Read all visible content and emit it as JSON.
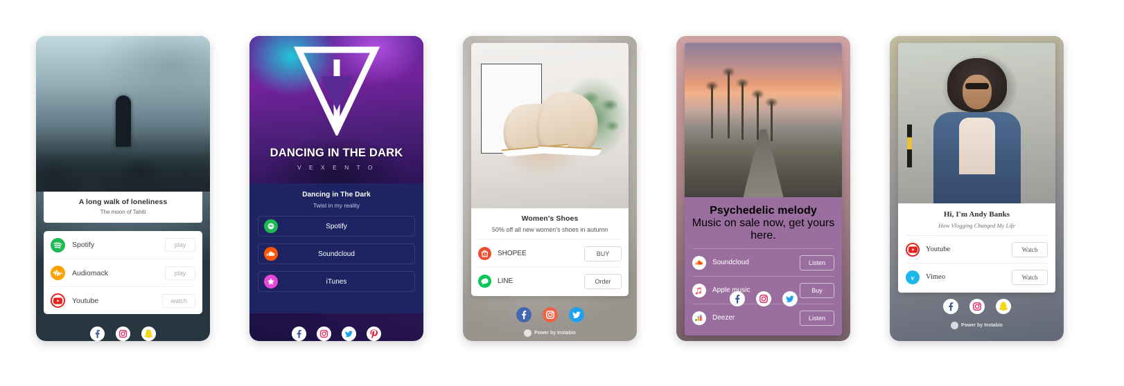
{
  "gallery": {
    "cards": [
      {
        "id": "card-music-loneliness",
        "theme_color": "#ffffff",
        "title": "A long walk of loneliness",
        "subtitle": "The moon of Tahiti",
        "links": [
          {
            "icon": "spotify-icon",
            "label": "Spotify",
            "action": "play"
          },
          {
            "icon": "audiomack-icon",
            "label": "Audiomack",
            "action": "play"
          },
          {
            "icon": "youtube-icon",
            "label": "Youtube",
            "action": "watch"
          }
        ],
        "social": [
          "facebook-icon",
          "instagram-icon",
          "snapchat-icon"
        ],
        "powered_by": ""
      },
      {
        "id": "card-dancing-in-the-dark",
        "theme_color": "#1e2461",
        "hero_title": "DANCING IN THE DARK",
        "hero_subtitle": "V E X E N T O",
        "title": "Dancing in The Dark",
        "subtitle": "Twist in my reality",
        "links": [
          {
            "icon": "spotify-icon",
            "label": "Spotify",
            "action": ""
          },
          {
            "icon": "soundcloud-icon",
            "label": "Soundcloud",
            "action": ""
          },
          {
            "icon": "itunes-icon",
            "label": "iTunes",
            "action": ""
          }
        ],
        "social": [
          "facebook-icon",
          "instagram-icon",
          "twitter-icon",
          "pinterest-icon"
        ],
        "powered_by": ""
      },
      {
        "id": "card-womens-shoes",
        "theme_color": "#ffffff",
        "title": "Women's Shoes",
        "subtitle": "50% off all new women's shoes in autumn",
        "links": [
          {
            "icon": "shopee-icon",
            "label": "SHOPEE",
            "action": "BUY"
          },
          {
            "icon": "line-icon",
            "label": "LINE",
            "action": "Order"
          }
        ],
        "social": [
          "facebook-icon",
          "instagram-icon",
          "twitter-icon"
        ],
        "powered_by": "Power by Instabio"
      },
      {
        "id": "card-psychedelic-melody",
        "theme_color": "#9a6e9e",
        "title": "Psychedelic melody",
        "subtitle": "Music on sale now, get yours here.",
        "links": [
          {
            "icon": "soundcloud-icon",
            "label": "Soundcloud",
            "action": "Listen"
          },
          {
            "icon": "apple-music-icon",
            "label": "Apple music",
            "action": "Buy"
          },
          {
            "icon": "deezer-icon",
            "label": "Deezer",
            "action": "Listen"
          }
        ],
        "social": [
          "facebook-icon",
          "instagram-icon",
          "twitter-icon"
        ],
        "powered_by": ""
      },
      {
        "id": "card-andy-banks",
        "theme_color": "#ffffff",
        "title": "Hi, I'm Andy Banks",
        "subtitle": "How Vlogging Changed My Life",
        "links": [
          {
            "icon": "youtube-icon",
            "label": "Youtube",
            "action": "Watch"
          },
          {
            "icon": "vimeo-icon",
            "label": "Vimeo",
            "action": "Watch"
          }
        ],
        "social": [
          "facebook-icon",
          "instagram-icon",
          "snapchat-icon"
        ],
        "powered_by": "Power by Instabio"
      }
    ]
  },
  "colors": {
    "spotify": "#1db954",
    "audiomack": "#ffa200",
    "youtube": "#e8201e",
    "soundcloud": "#ff5500",
    "itunes": "#e747d9",
    "shopee": "#ee4d2d",
    "line": "#06c755",
    "apple_music": "#fa586a",
    "deezer": "#ffffff",
    "vimeo": "#1ab7ea",
    "facebook": "#3b5998",
    "instagram": "#e1306c",
    "twitter": "#1da1f2",
    "snapchat": "#fffc00",
    "pinterest": "#e60023"
  }
}
